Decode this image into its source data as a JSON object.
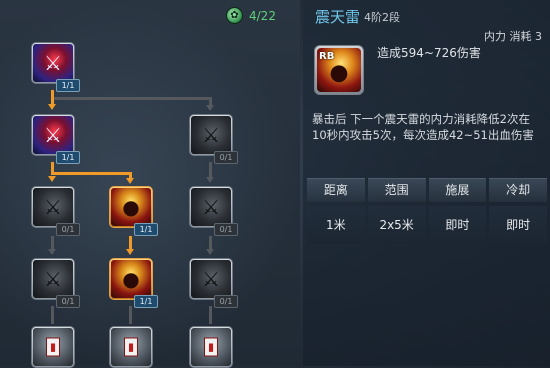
{
  "points": {
    "icon": "jade-orb-icon",
    "glyph": "✿",
    "value": "4/22"
  },
  "tree": {
    "nodes": [
      {
        "id": "r1c1",
        "state": "learned",
        "level": "1/1"
      },
      {
        "id": "r2c1",
        "state": "learned",
        "level": "1/1"
      },
      {
        "id": "r2c3",
        "state": "locked",
        "level": "0/1"
      },
      {
        "id": "r3c1",
        "state": "locked",
        "level": "0/1"
      },
      {
        "id": "r3c2",
        "state": "gold",
        "level": "1/1"
      },
      {
        "id": "r3c3",
        "state": "locked",
        "level": "0/1"
      },
      {
        "id": "r4c1",
        "state": "locked",
        "level": "0/1"
      },
      {
        "id": "r4c2",
        "state": "gold",
        "level": "1/1"
      },
      {
        "id": "r4c3",
        "state": "locked",
        "level": "0/1"
      },
      {
        "id": "r5c1",
        "state": "card",
        "level": ""
      },
      {
        "id": "r5c2",
        "state": "card",
        "level": ""
      },
      {
        "id": "r5c3",
        "state": "card",
        "level": ""
      }
    ]
  },
  "skill": {
    "name": "震天雷",
    "tier": "4阶2段",
    "cost": "内力 消耗 3",
    "icon_label": "RB",
    "damage": "造成594~726伤害",
    "description": "暴击后 下一个震天雷的内力消耗降低2次在10秒内攻击5次，每次造成42~51出血伤害"
  },
  "stats": {
    "headers": [
      "距离",
      "范围",
      "施展",
      "冷却"
    ],
    "values": [
      "1米",
      "2x5米",
      "即时",
      "即时"
    ]
  },
  "colors": {
    "skill_name": "#6fc7ea",
    "points": "#5fd07a",
    "path_active": "#f09a2a",
    "path_inactive": "#55595e"
  }
}
